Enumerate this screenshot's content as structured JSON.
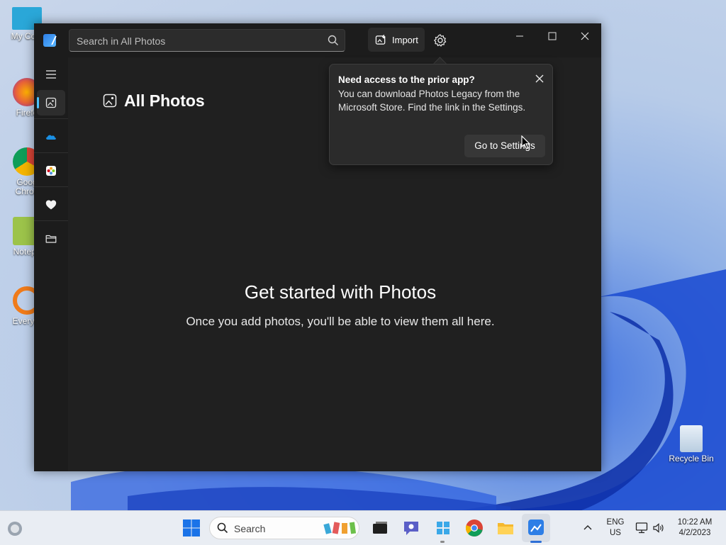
{
  "desktop": {
    "icons": [
      {
        "label": "My Com",
        "color": "#2aa7d8"
      },
      {
        "label": "Firefo",
        "color": "#e8603a"
      },
      {
        "label": "Goog\nChron",
        "color": "#3a9b4a"
      },
      {
        "label": "Notepa",
        "color": "#9cc34a"
      },
      {
        "label": "Everyth",
        "color": "#f07b1a"
      }
    ],
    "recycle_bin_label": "Recycle Bin"
  },
  "window": {
    "search": {
      "placeholder": "Search in All Photos"
    },
    "toolbar": {
      "import_label": "Import"
    }
  },
  "nav": {
    "items": [
      "menu",
      "all-photos",
      "onedrive",
      "icloud",
      "favorites",
      "folders"
    ]
  },
  "main": {
    "page_title": "All Photos",
    "empty_title": "Get started with Photos",
    "empty_subtitle": "Once you add photos, you'll be able to view them all here."
  },
  "teaching_tip": {
    "title": "Need access to the prior app?",
    "body": "You can download Photos Legacy from the Microsoft Store. Find the link in the Settings.",
    "action_label": "Go to Settings"
  },
  "taskbar": {
    "search_label": "Search",
    "lang_line1": "ENG",
    "lang_line2": "US",
    "time": "10:22 AM",
    "date": "4/2/2023"
  },
  "colors": {
    "accent": "#4cc2ff",
    "window_bg": "#202020",
    "taskbar_accent": "#2d6fd6"
  }
}
